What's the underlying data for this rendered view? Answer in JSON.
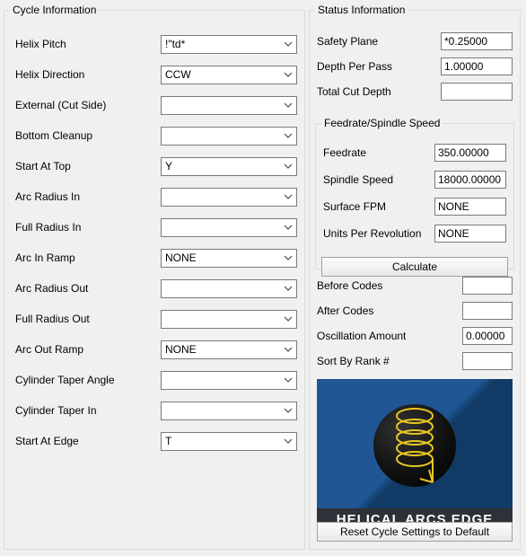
{
  "groups": {
    "cycle_title": "Cycle Information",
    "status_title": "Status Information",
    "feed_title": "Feedrate/Spindle Speed"
  },
  "cycle": {
    "helix_pitch": {
      "label": "Helix Pitch",
      "value": "!\"td*"
    },
    "helix_direction": {
      "label": "Helix Direction",
      "value": "CCW"
    },
    "external_cut_side": {
      "label": "External (Cut Side)",
      "value": ""
    },
    "bottom_cleanup": {
      "label": "Bottom Cleanup",
      "value": ""
    },
    "start_at_top": {
      "label": "Start At Top",
      "value": "Y"
    },
    "arc_radius_in": {
      "label": "Arc Radius In",
      "value": ""
    },
    "full_radius_in": {
      "label": "Full Radius In",
      "value": ""
    },
    "arc_in_ramp": {
      "label": "Arc In Ramp",
      "value": "NONE"
    },
    "arc_radius_out": {
      "label": "Arc Radius Out",
      "value": ""
    },
    "full_radius_out": {
      "label": "Full Radius Out",
      "value": ""
    },
    "arc_out_ramp": {
      "label": "Arc Out Ramp",
      "value": "NONE"
    },
    "cyl_taper_angle": {
      "label": "Cylinder Taper Angle",
      "value": ""
    },
    "cyl_taper_in": {
      "label": "Cylinder Taper In",
      "value": ""
    },
    "start_at_edge": {
      "label": "Start At Edge",
      "value": "T"
    }
  },
  "status": {
    "safety_plane": {
      "label": "Safety Plane",
      "value": "*0.25000"
    },
    "depth_per_pass": {
      "label": "Depth Per Pass",
      "value": "1.00000"
    },
    "total_cut_depth": {
      "label": "Total Cut Depth",
      "value": ""
    }
  },
  "feed": {
    "feedrate": {
      "label": "Feedrate",
      "value": "350.00000"
    },
    "spindle_speed": {
      "label": "Spindle Speed",
      "value": "18000.00000"
    },
    "surface_fpm": {
      "label": "Surface FPM",
      "value": "NONE"
    },
    "units_per_rev": {
      "label": "Units Per Revolution",
      "value": "NONE"
    },
    "calculate_label": "Calculate"
  },
  "status2": {
    "before_codes": {
      "label": "Before Codes",
      "value": ""
    },
    "after_codes": {
      "label": "After Codes",
      "value": ""
    },
    "oscillation_amount": {
      "label": "Oscillation Amount",
      "value": "0.00000"
    },
    "sort_by_rank": {
      "label": "Sort By Rank #",
      "value": ""
    }
  },
  "illustration": {
    "caption": "HELICAL ARCS EDGE"
  },
  "buttons": {
    "reset_label": "Reset Cycle Settings to Default"
  }
}
